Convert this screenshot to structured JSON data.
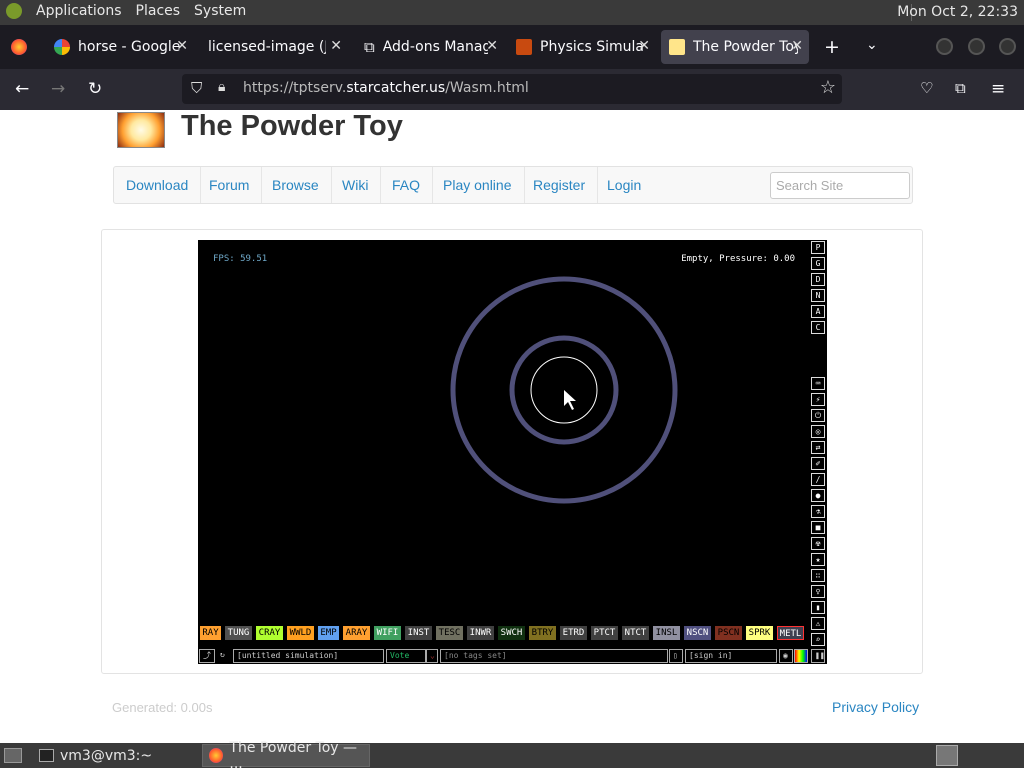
{
  "gnome": {
    "menus": [
      "Applications",
      "Places",
      "System"
    ],
    "clock": "Mon Oct  2, 22:33"
  },
  "tabs": [
    {
      "title": "horse - Google S",
      "icon": "google-icon"
    },
    {
      "title": "licensed-image (JPE",
      "icon": "image-icon"
    },
    {
      "title": "Add-ons Manage",
      "icon": "puzzle-icon"
    },
    {
      "title": "Physics Simulati",
      "icon": "physics-icon"
    },
    {
      "title": "The Powder Toy",
      "icon": "powder-toy-icon",
      "active": true
    }
  ],
  "url": {
    "prefix": "https://tptserv.",
    "domain": "starcatcher.us",
    "path": "/Wasm.html"
  },
  "site": {
    "title": "The Powder Toy",
    "menu": [
      "Download",
      "Forum",
      "Browse",
      "Wiki",
      "FAQ",
      "Play online",
      "Register",
      "Login"
    ],
    "search_placeholder": "Search Site",
    "generated": "Generated: 0.00s",
    "privacy": "Privacy Policy"
  },
  "sim": {
    "fps": "FPS: 59.51",
    "status": "Empty, Pressure: 0.00",
    "right_letters": [
      "P",
      "G",
      "D",
      "N",
      "A",
      "C"
    ],
    "elements": [
      {
        "name": "RAY",
        "bg": "#ffa030",
        "fg": "#000"
      },
      {
        "name": "TUNG",
        "bg": "#505050",
        "fg": "#fff"
      },
      {
        "name": "CRAY",
        "bg": "#b0ff30",
        "fg": "#000"
      },
      {
        "name": "WWLD",
        "bg": "#ffa020",
        "fg": "#000"
      },
      {
        "name": "EMP",
        "bg": "#60a0f0",
        "fg": "#000"
      },
      {
        "name": "ARAY",
        "bg": "#ffa030",
        "fg": "#000"
      },
      {
        "name": "WIFI",
        "bg": "#40a060",
        "fg": "#fff"
      },
      {
        "name": "INST",
        "bg": "#404040",
        "fg": "#fff"
      },
      {
        "name": "TESC",
        "bg": "#707060",
        "fg": "#000"
      },
      {
        "name": "INWR",
        "bg": "#404040",
        "fg": "#fff"
      },
      {
        "name": "SWCH",
        "bg": "#103010",
        "fg": "#fff"
      },
      {
        "name": "BTRY",
        "bg": "#807020",
        "fg": "#000"
      },
      {
        "name": "ETRD",
        "bg": "#404040",
        "fg": "#fff"
      },
      {
        "name": "PTCT",
        "bg": "#404040",
        "fg": "#fff"
      },
      {
        "name": "NTCT",
        "bg": "#404040",
        "fg": "#fff"
      },
      {
        "name": "INSL",
        "bg": "#9090a0",
        "fg": "#000"
      },
      {
        "name": "NSCN",
        "bg": "#505080",
        "fg": "#fff"
      },
      {
        "name": "PSCN",
        "bg": "#803020",
        "fg": "#000"
      },
      {
        "name": "SPRK",
        "bg": "#ffff80",
        "fg": "#000"
      },
      {
        "name": "METL",
        "bg": "#404050",
        "fg": "#fff"
      }
    ],
    "bottom": {
      "save": "[untitled simulation]",
      "vote": "Vote",
      "tags": "[no tags set]",
      "signin": "[sign in]"
    }
  },
  "taskbar": {
    "terminal": "vm3@vm3:~",
    "browser": "The Powder Toy — ..."
  }
}
